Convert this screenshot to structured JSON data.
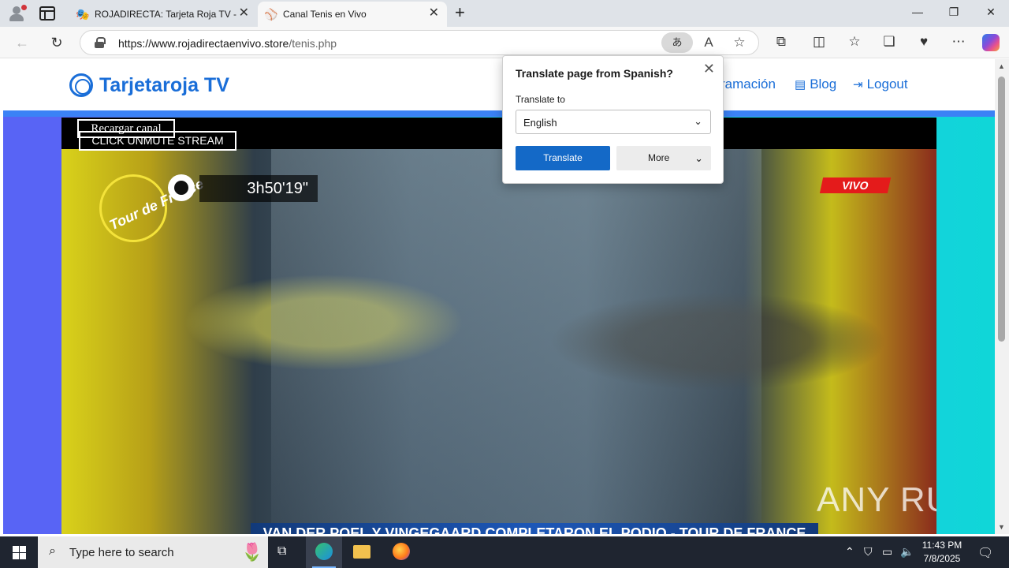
{
  "browser": {
    "tabs": [
      {
        "title": "ROJADIRECTA: Tarjeta Roja TV - Pr",
        "close": "✕"
      },
      {
        "title": "Canal Tenis en Vivo",
        "close": "✕"
      }
    ],
    "new_tab": "+",
    "window_controls": {
      "minimize": "—",
      "restore": "❐",
      "close": "✕"
    },
    "address": {
      "host": "https://www.rojadirectaenvivo.store",
      "path": "/tenis.php"
    },
    "translate_glyph": "あ"
  },
  "site": {
    "brand": "Tarjetaroja TV",
    "nav": [
      {
        "label": "ramación",
        "icon": "calendar-icon"
      },
      {
        "label": "Blog",
        "icon": "newspaper-icon"
      },
      {
        "label": "Logout",
        "icon": "logout-icon"
      }
    ]
  },
  "player": {
    "reload_label": "Recargar canal",
    "unmute_label": "CLICK UNMUTE STREAM",
    "timer": "3h50'19\"",
    "live_badge": "VIVO",
    "logo_text": "Tour de France",
    "ticker": "VAN DER POEL Y VINGEGAARD COMPLETARON EL PODIO - TOUR DE FRANCE",
    "watermark": "ANY RUN"
  },
  "translate_popup": {
    "title": "Translate page from Spanish?",
    "label": "Translate to",
    "selected_language": "English",
    "translate_button": "Translate",
    "more_button": "More",
    "close": "✕"
  },
  "taskbar": {
    "search_placeholder": "Type here to search",
    "time": "11:43 PM",
    "date": "7/8/2025"
  }
}
